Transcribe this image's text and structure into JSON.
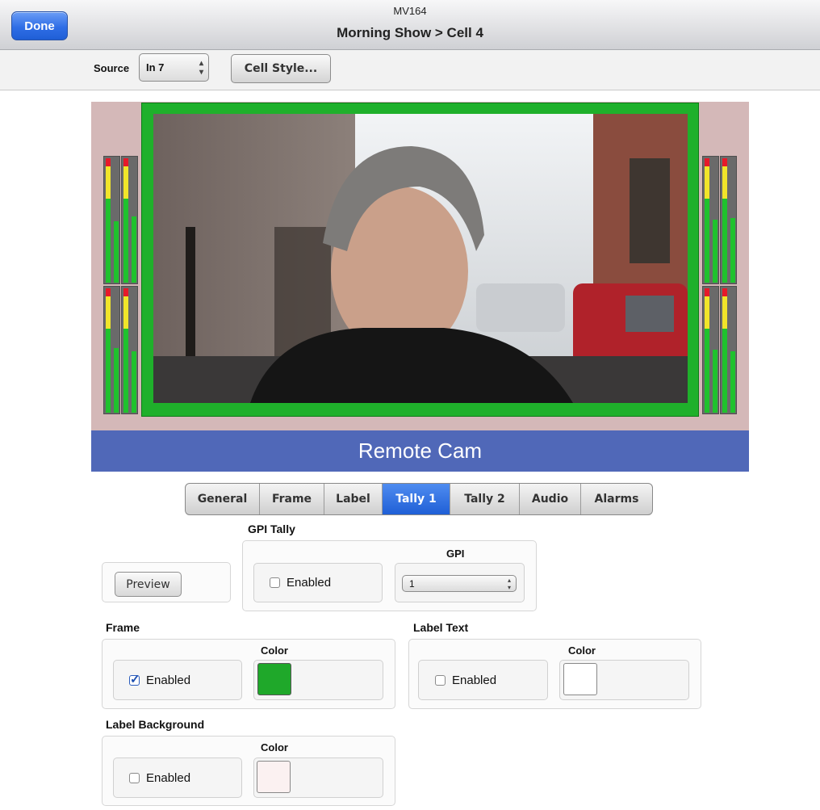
{
  "header": {
    "device": "MV164",
    "title": "Morning Show > Cell 4",
    "done_label": "Done"
  },
  "toolbar": {
    "source_label": "Source",
    "source_value": "In 7",
    "cell_style_label": "Cell Style..."
  },
  "cell": {
    "label": "Remote Cam",
    "frame_color": "#1fb02b",
    "label_bg_color": "#5068b8"
  },
  "tabs": [
    {
      "label": "General",
      "active": false
    },
    {
      "label": "Frame",
      "active": false
    },
    {
      "label": "Label",
      "active": false
    },
    {
      "label": "Tally 1",
      "active": true
    },
    {
      "label": "Tally 2",
      "active": false
    },
    {
      "label": "Audio",
      "active": false
    },
    {
      "label": "Alarms",
      "active": false
    }
  ],
  "preview": {
    "button_label": "Preview"
  },
  "gpi_tally": {
    "title": "GPI Tally",
    "enabled_label": "Enabled",
    "enabled": false,
    "gpi_label": "GPI",
    "gpi_value": "1"
  },
  "frame": {
    "title": "Frame",
    "enabled_label": "Enabled",
    "enabled": true,
    "color_label": "Color",
    "color": "#1fa82a"
  },
  "label_text": {
    "title": "Label Text",
    "enabled_label": "Enabled",
    "enabled": false,
    "color_label": "Color",
    "color": "#ffffff"
  },
  "label_background": {
    "title": "Label Background",
    "enabled_label": "Enabled",
    "enabled": false,
    "color_label": "Color",
    "color": "#fbf1f1"
  }
}
